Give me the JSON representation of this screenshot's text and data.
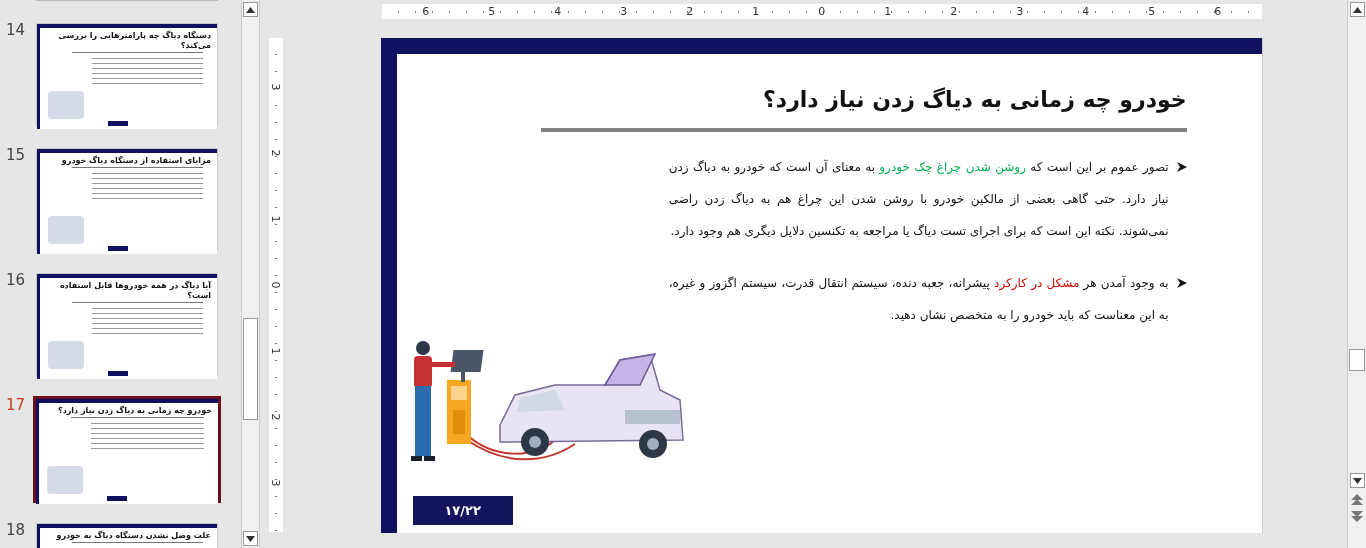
{
  "thumbnails": [
    {
      "number": "14",
      "title": "دستگاه دیاگ چه پارامترهایی را بررسی می‌کند؟",
      "selected": false
    },
    {
      "number": "15",
      "title": "مزایای استفاده از دستگاه دیاگ خودرو",
      "selected": false
    },
    {
      "number": "16",
      "title": "آیا دیاگ در همه خودروها قابل استفاده است؟",
      "selected": false
    },
    {
      "number": "17",
      "title": "خودرو چه زمانی به دیاگ زدن نیاز دارد؟",
      "selected": true
    },
    {
      "number": "18",
      "title": "علت وصل نشدن دستگاه دیاگ به خودرو",
      "selected": false
    }
  ],
  "ruler_horizontal": [
    "6",
    "5",
    "4",
    "3",
    "2",
    "1",
    "0",
    "1",
    "2",
    "3",
    "4",
    "5",
    "6"
  ],
  "ruler_vertical": [
    "3",
    "2",
    "1",
    "0",
    "1",
    "2",
    "3"
  ],
  "slide": {
    "title": "خودرو چه زمانی به دیاگ زدن نیاز دارد؟",
    "bullets": [
      {
        "segments": [
          {
            "text": "تصور عموم بر این است که "
          },
          {
            "text": "روشن شدن چراغ چک خودرو",
            "color": "#00b050"
          },
          {
            "text": " به معنای آن است که خودرو به دیاگ زدن نیاز دارد. حتی گاهی بعضی از مالکین خودرو با روشن شدن این چراغ هم به دیاگ زدن راضی نمی‌شوند. نکته این است که برای اجرای تست دیاگ یا مراجعه به تکنسین دلایل دیگری هم وجود دارد."
          }
        ]
      },
      {
        "segments": [
          {
            "text": "به وجود آمدن هر "
          },
          {
            "text": "مشکل در کارکرد",
            "color": "#e00000"
          },
          {
            "text": " پیشرانه، جعبه دنده، سیستم انتقال قدرت، سیستم اگزوز و غیره، به این معناست که باید خودرو را به متخصص نشان دهید."
          }
        ]
      }
    ],
    "page_number": "۱۷/۲۲"
  }
}
